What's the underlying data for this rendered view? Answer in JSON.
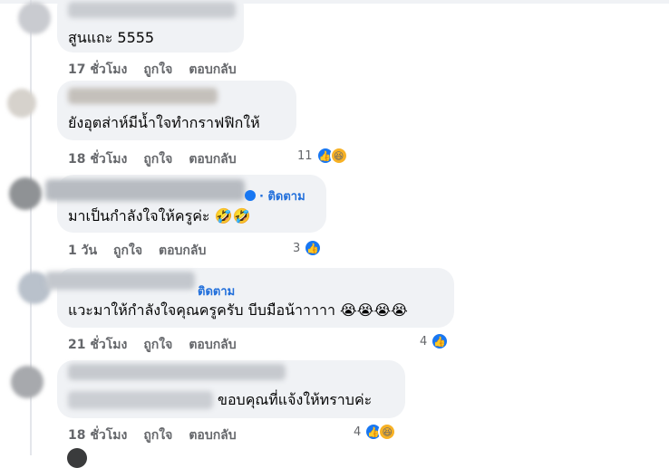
{
  "colors": {
    "bubble": "#f0f2f5",
    "meta": "#65676b",
    "follow": "#216fdb",
    "like": "#1877f2"
  },
  "comments": [
    {
      "text": "สูนแถะ 5555",
      "time": "17 ชั่วโมง",
      "like": "ถูกใจ",
      "reply": "ตอบกลับ"
    },
    {
      "text": "ยังอุตส่าห์มีน้ำใจทำกราฟฟิกให้",
      "time": "18 ชั่วโมง",
      "like": "ถูกใจ",
      "reply": "ตอบกลับ",
      "reaction_count": "11",
      "reactions": [
        "like-icon",
        "haha-icon"
      ]
    },
    {
      "follow": "· ติดตาม",
      "text": "มาเป็นกำลังใจให้ครูค่ะ 🤣🤣",
      "time": "1 วัน",
      "like": "ถูกใจ",
      "reply": "ตอบกลับ",
      "reaction_count": "3",
      "reactions": [
        "like-icon"
      ]
    },
    {
      "follow": "ติดตาม",
      "text": "แวะมาให้กำลังใจคุณครูครับ บีบมือน้าาาาา 😭😭😭😭",
      "time": "21 ชั่วโมง",
      "like": "ถูกใจ",
      "reply": "ตอบกลับ",
      "reaction_count": "4",
      "reactions": [
        "like-icon"
      ]
    },
    {
      "text": "ขอบคุณที่แจ้งให้ทราบค่ะ",
      "time": "18 ชั่วโมง",
      "like": "ถูกใจ",
      "reply": "ตอบกลับ",
      "reaction_count": "4",
      "reactions": [
        "like-icon",
        "haha-icon"
      ]
    }
  ]
}
